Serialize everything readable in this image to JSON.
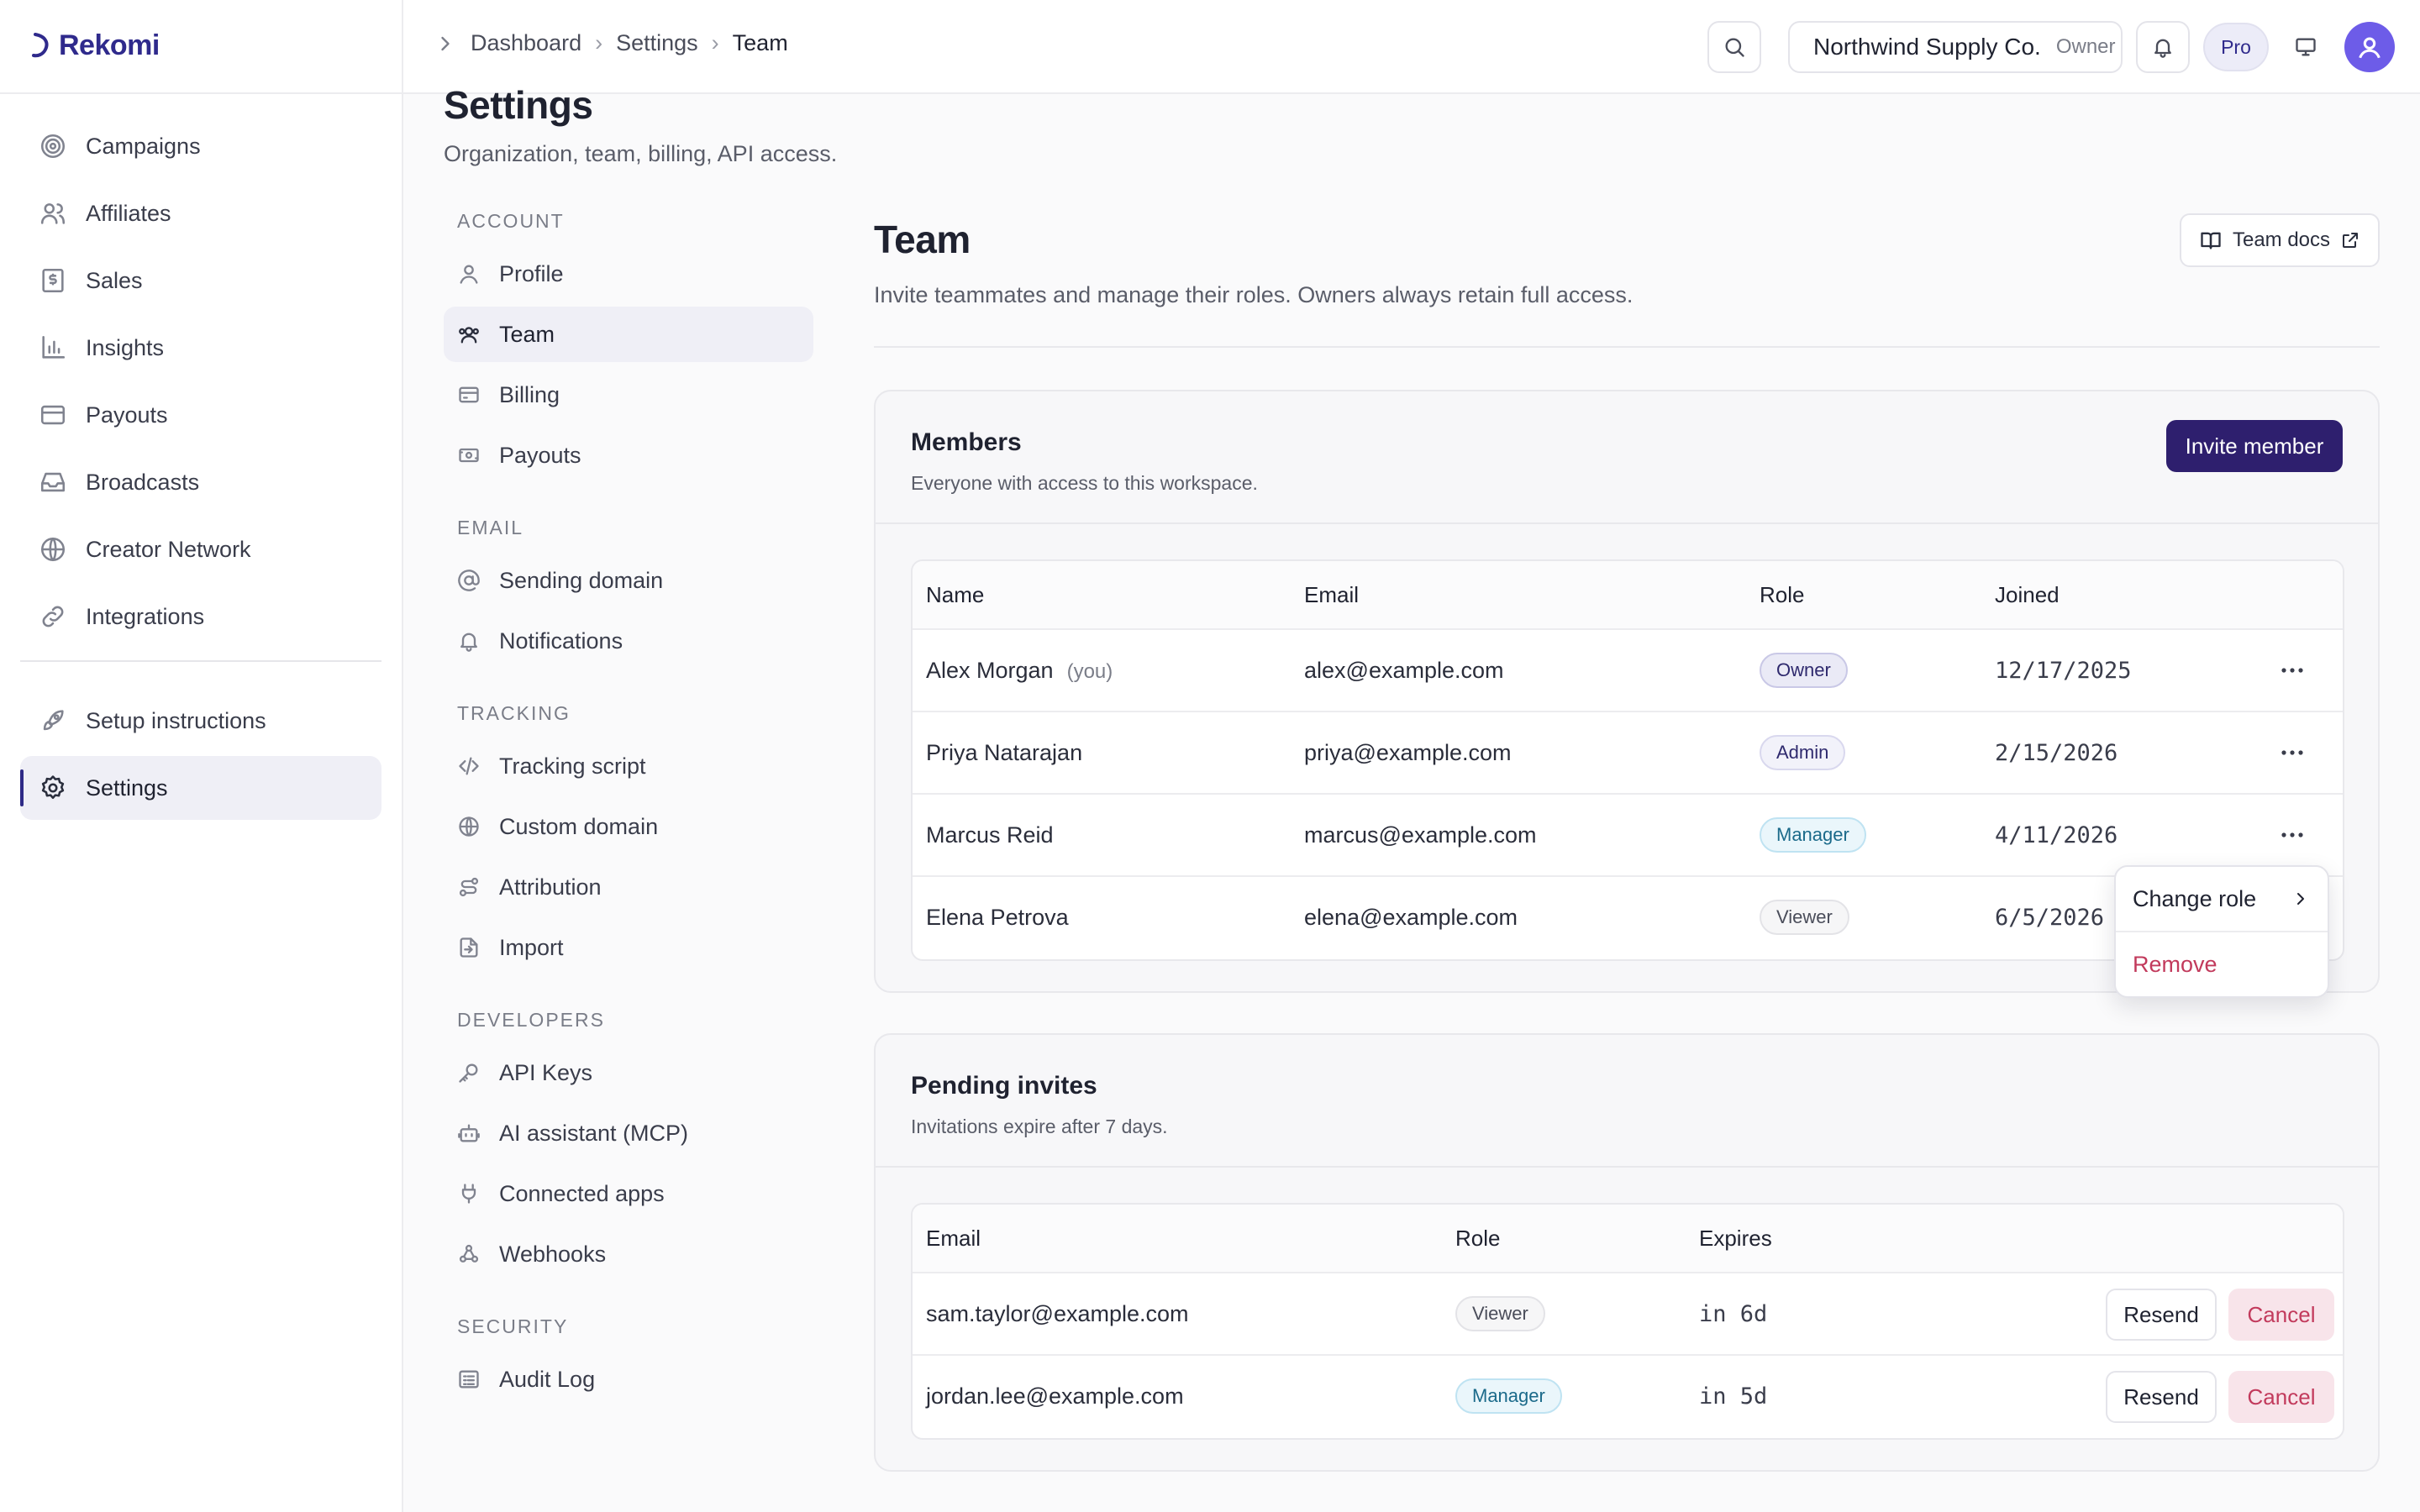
{
  "app": {
    "name": "Rekomi"
  },
  "sidebar": {
    "items": [
      {
        "label": "Campaigns",
        "icon": "target-icon"
      },
      {
        "label": "Affiliates",
        "icon": "users-icon"
      },
      {
        "label": "Sales",
        "icon": "receipt-icon"
      },
      {
        "label": "Insights",
        "icon": "bar-chart-icon"
      },
      {
        "label": "Payouts",
        "icon": "credit-card-icon"
      },
      {
        "label": "Broadcasts",
        "icon": "inbox-icon"
      },
      {
        "label": "Creator Network",
        "icon": "globe-icon"
      },
      {
        "label": "Integrations",
        "icon": "link-icon"
      }
    ],
    "bottom_items": [
      {
        "label": "Setup instructions",
        "icon": "rocket-icon"
      },
      {
        "label": "Settings",
        "icon": "gear-icon",
        "active": true
      }
    ]
  },
  "topbar": {
    "breadcrumb": [
      "Dashboard",
      "Settings",
      "Team"
    ],
    "org_name": "Northwind Supply Co.",
    "org_role": "Owner",
    "plan": "Pro"
  },
  "settings": {
    "title": "Settings",
    "subtitle": "Organization, team, billing, API access.",
    "sections": [
      {
        "heading": "ACCOUNT",
        "items": [
          "Profile",
          "Team",
          "Billing",
          "Payouts"
        ]
      },
      {
        "heading": "EMAIL",
        "items": [
          "Sending domain",
          "Notifications"
        ]
      },
      {
        "heading": "TRACKING",
        "items": [
          "Tracking script",
          "Custom domain",
          "Attribution",
          "Import"
        ]
      },
      {
        "heading": "DEVELOPERS",
        "items": [
          "API Keys",
          "AI assistant (MCP)",
          "Connected apps",
          "Webhooks"
        ]
      },
      {
        "heading": "SECURITY",
        "items": [
          "Audit Log"
        ]
      }
    ]
  },
  "team": {
    "title": "Team",
    "subtitle": "Invite teammates and manage their roles. Owners always retain full access.",
    "docs_label": "Team docs",
    "members": {
      "title": "Members",
      "description": "Everyone with access to this workspace.",
      "invite_label": "Invite member",
      "columns": [
        "Name",
        "Email",
        "Role",
        "Joined"
      ],
      "you_label": "(you)",
      "rows": [
        {
          "name": "Alex Morgan",
          "email": "alex@example.com",
          "role": "Owner",
          "joined": "12/17/2025"
        },
        {
          "name": "Priya Natarajan",
          "email": "priya@example.com",
          "role": "Admin",
          "joined": "2/15/2026"
        },
        {
          "name": "Marcus Reid",
          "email": "marcus@example.com",
          "role": "Manager",
          "joined": "4/11/2026"
        },
        {
          "name": "Elena Petrova",
          "email": "elena@example.com",
          "role": "Viewer",
          "joined": "6/5/2026"
        }
      ]
    },
    "row_menu": {
      "change_role": "Change role",
      "remove": "Remove"
    },
    "pending": {
      "title": "Pending invites",
      "description": "Invitations expire after 7 days.",
      "columns": [
        "Email",
        "Role",
        "Expires"
      ],
      "resend_label": "Resend",
      "cancel_label": "Cancel",
      "rows": [
        {
          "email": "sam.taylor@example.com",
          "role": "Viewer",
          "expires": "in 6d"
        },
        {
          "email": "jordan.lee@example.com",
          "role": "Manager",
          "expires": "in 5d"
        }
      ]
    }
  },
  "colors": {
    "accent": "#2e1f6e",
    "danger": "#c23a5c",
    "active_bg": "#efeff6"
  }
}
